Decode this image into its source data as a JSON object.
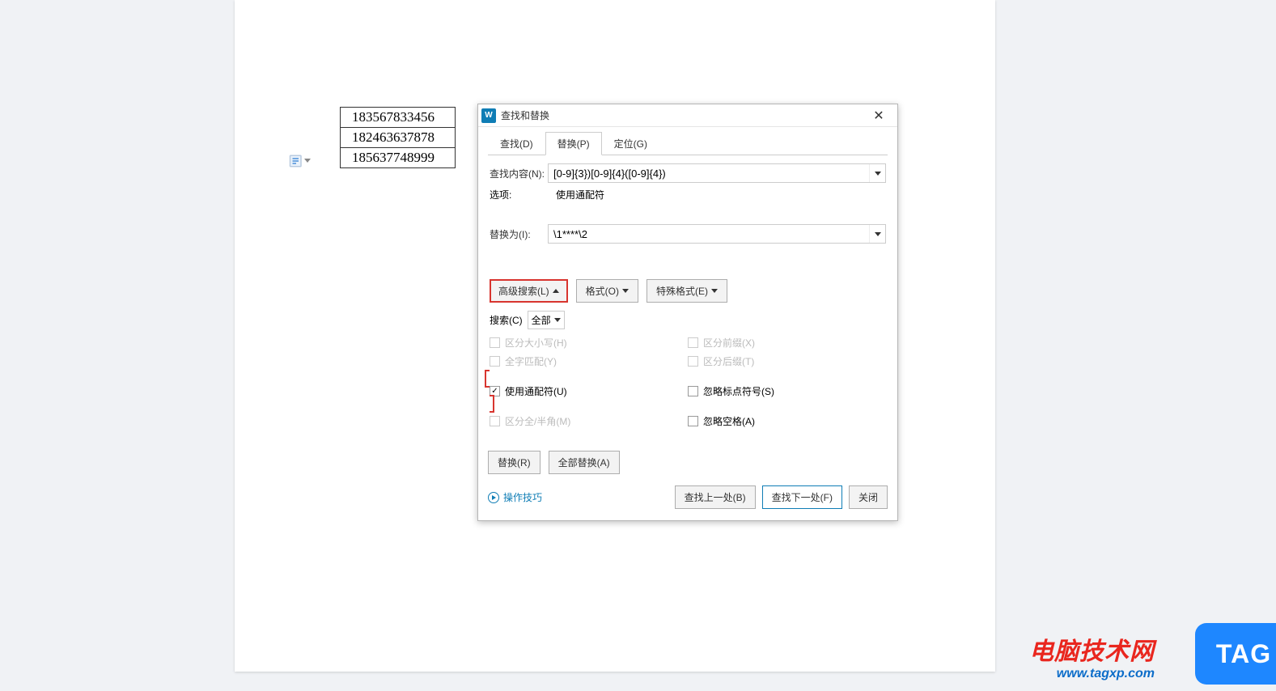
{
  "document": {
    "phone_numbers": [
      "183567833456",
      "182463637878",
      "185637748999"
    ]
  },
  "dialog": {
    "title": "查找和替换",
    "tabs": {
      "find": "查找(D)",
      "replace": "替换(P)",
      "goto": "定位(G)"
    },
    "find_label": "查找内容(N):",
    "find_value": "[0-9]{3})[0-9]{4}([0-9]{4})",
    "options_label": "选项:",
    "options_value": "使用通配符",
    "replace_label": "替换为(I):",
    "replace_value": "\\1****\\2",
    "advanced_btn": "高级搜索(L)",
    "format_btn": "格式(O)",
    "special_btn": "特殊格式(E)",
    "search_scope_label": "搜索(C)",
    "search_scope_value": "全部",
    "checks": {
      "match_case": "区分大小写(H)",
      "whole_word": "全字匹配(Y)",
      "wildcards": "使用通配符(U)",
      "halfwidth": "区分全/半角(M)",
      "prefix": "区分前缀(X)",
      "suffix": "区分后缀(T)",
      "ignore_punct": "忽略标点符号(S)",
      "ignore_space": "忽略空格(A)"
    },
    "replace_btn": "替换(R)",
    "replace_all_btn": "全部替换(A)",
    "tips_link": "操作技巧",
    "find_prev_btn": "查找上一处(B)",
    "find_next_btn": "查找下一处(F)",
    "close_btn": "关闭"
  },
  "brand": {
    "name": "电脑技术网",
    "url": "www.tagxp.com",
    "badge": "TAG"
  }
}
